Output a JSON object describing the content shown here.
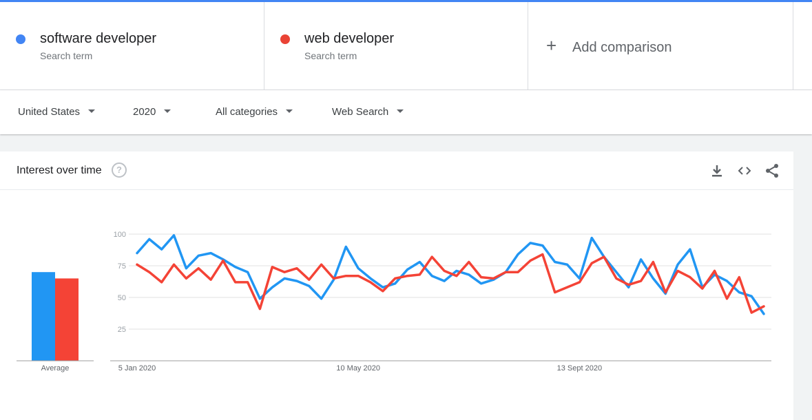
{
  "terms": [
    {
      "name": "software developer",
      "sub": "Search term",
      "color": "#4285f4"
    },
    {
      "name": "web developer",
      "sub": "Search term",
      "color": "#ea4335"
    }
  ],
  "add_comparison": "Add comparison",
  "filters": {
    "region": "United States",
    "time": "2020",
    "category": "All categories",
    "search_type": "Web Search"
  },
  "card": {
    "title": "Interest over time",
    "icons": [
      "help-icon",
      "download-icon",
      "embed-icon",
      "share-icon"
    ]
  },
  "chart_data": {
    "type": "line",
    "title": "Interest over time",
    "ylim": [
      0,
      100
    ],
    "yticks": [
      25,
      50,
      75,
      100
    ],
    "x_start": "5 Jan 2020",
    "x_tick_labels": [
      {
        "label": "5 Jan 2020",
        "index": 0
      },
      {
        "label": "10 May 2020",
        "index": 18
      },
      {
        "label": "13 Sept 2020",
        "index": 36
      }
    ],
    "grid": true,
    "series": [
      {
        "name": "software developer",
        "color": "#2196f3",
        "average": 70,
        "values": [
          85,
          96,
          88,
          99,
          73,
          83,
          85,
          80,
          74,
          70,
          49,
          58,
          65,
          63,
          59,
          49,
          64,
          90,
          73,
          65,
          58,
          61,
          72,
          78,
          67,
          63,
          71,
          68,
          61,
          64,
          70,
          84,
          93,
          91,
          78,
          76,
          65,
          97,
          82,
          70,
          58,
          80,
          65,
          53,
          76,
          88,
          58,
          68,
          63,
          54,
          51,
          37
        ]
      },
      {
        "name": "web developer",
        "color": "#f44336",
        "average": 65,
        "values": [
          76,
          70,
          62,
          76,
          65,
          73,
          64,
          79,
          62,
          62,
          41,
          74,
          70,
          73,
          64,
          76,
          65,
          67,
          67,
          62,
          55,
          65,
          67,
          68,
          82,
          71,
          67,
          78,
          66,
          65,
          70,
          70,
          79,
          84,
          54,
          58,
          62,
          77,
          82,
          65,
          60,
          63,
          78,
          54,
          71,
          66,
          57,
          71,
          49,
          66,
          38,
          43
        ]
      }
    ],
    "average_label": "Average"
  }
}
